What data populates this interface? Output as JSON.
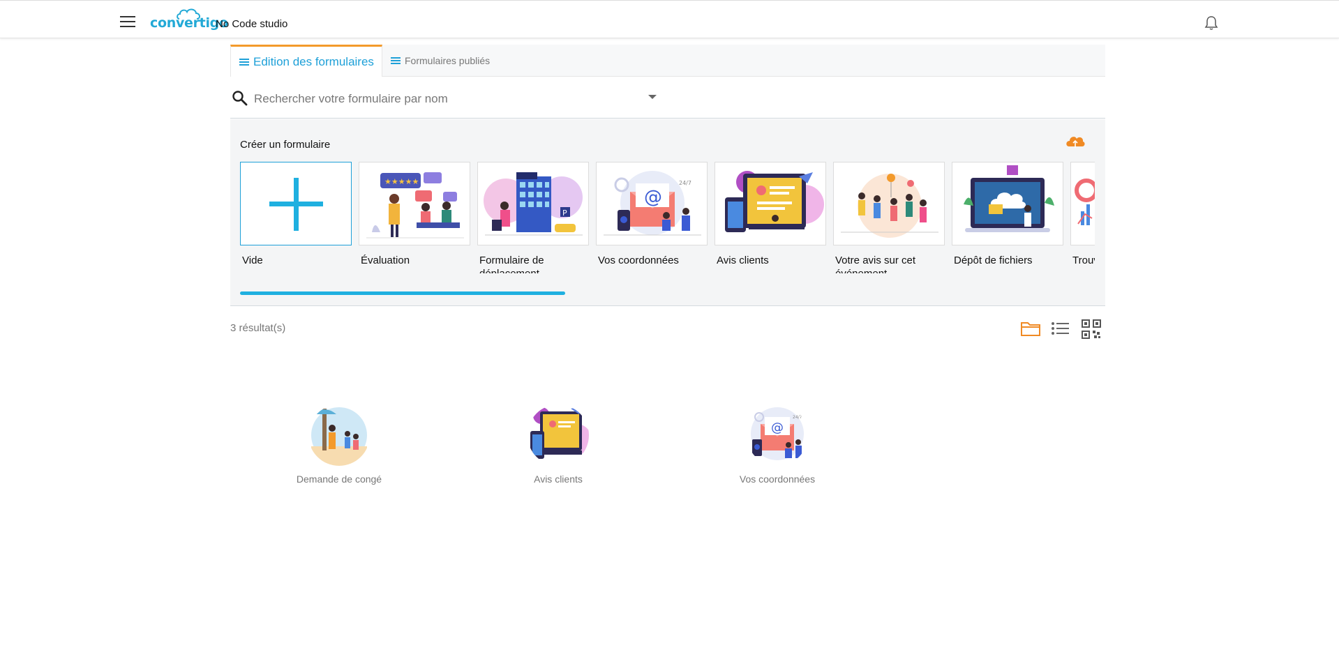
{
  "header": {
    "logo_text": "convertigo",
    "studio_label": "No Code studio"
  },
  "tabs": [
    {
      "label": "Edition des formulaires",
      "active": true
    },
    {
      "label": "Formulaires publiés",
      "active": false
    }
  ],
  "search": {
    "placeholder": "Rechercher votre formulaire par nom",
    "value": ""
  },
  "create": {
    "title": "Créer un formulaire",
    "templates": [
      {
        "label": "Vide",
        "icon": "plus-icon"
      },
      {
        "label": "Évaluation",
        "icon": "evaluation-illustration"
      },
      {
        "label": "Formulaire de déplacement",
        "icon": "hotel-illustration"
      },
      {
        "label": "Vos coordonnées",
        "icon": "email-illustration"
      },
      {
        "label": "Avis clients",
        "icon": "customer-review-illustration"
      },
      {
        "label": "Votre avis sur cet événement",
        "icon": "party-illustration"
      },
      {
        "label": "Dépôt de fichiers",
        "icon": "file-upload-illustration"
      },
      {
        "label": "Trouver un horaire",
        "icon": "chart-illustration"
      }
    ]
  },
  "results": {
    "count_label": "3 résultat(s)",
    "items": [
      {
        "name": "Demande de congé",
        "icon": "beach-illustration"
      },
      {
        "name": "Avis clients",
        "icon": "customer-review-illustration"
      },
      {
        "name": "Vos coordonnées",
        "icon": "email-illustration"
      }
    ]
  },
  "colors": {
    "accent_blue": "#1ea0d8",
    "accent_orange": "#f39a2b"
  }
}
